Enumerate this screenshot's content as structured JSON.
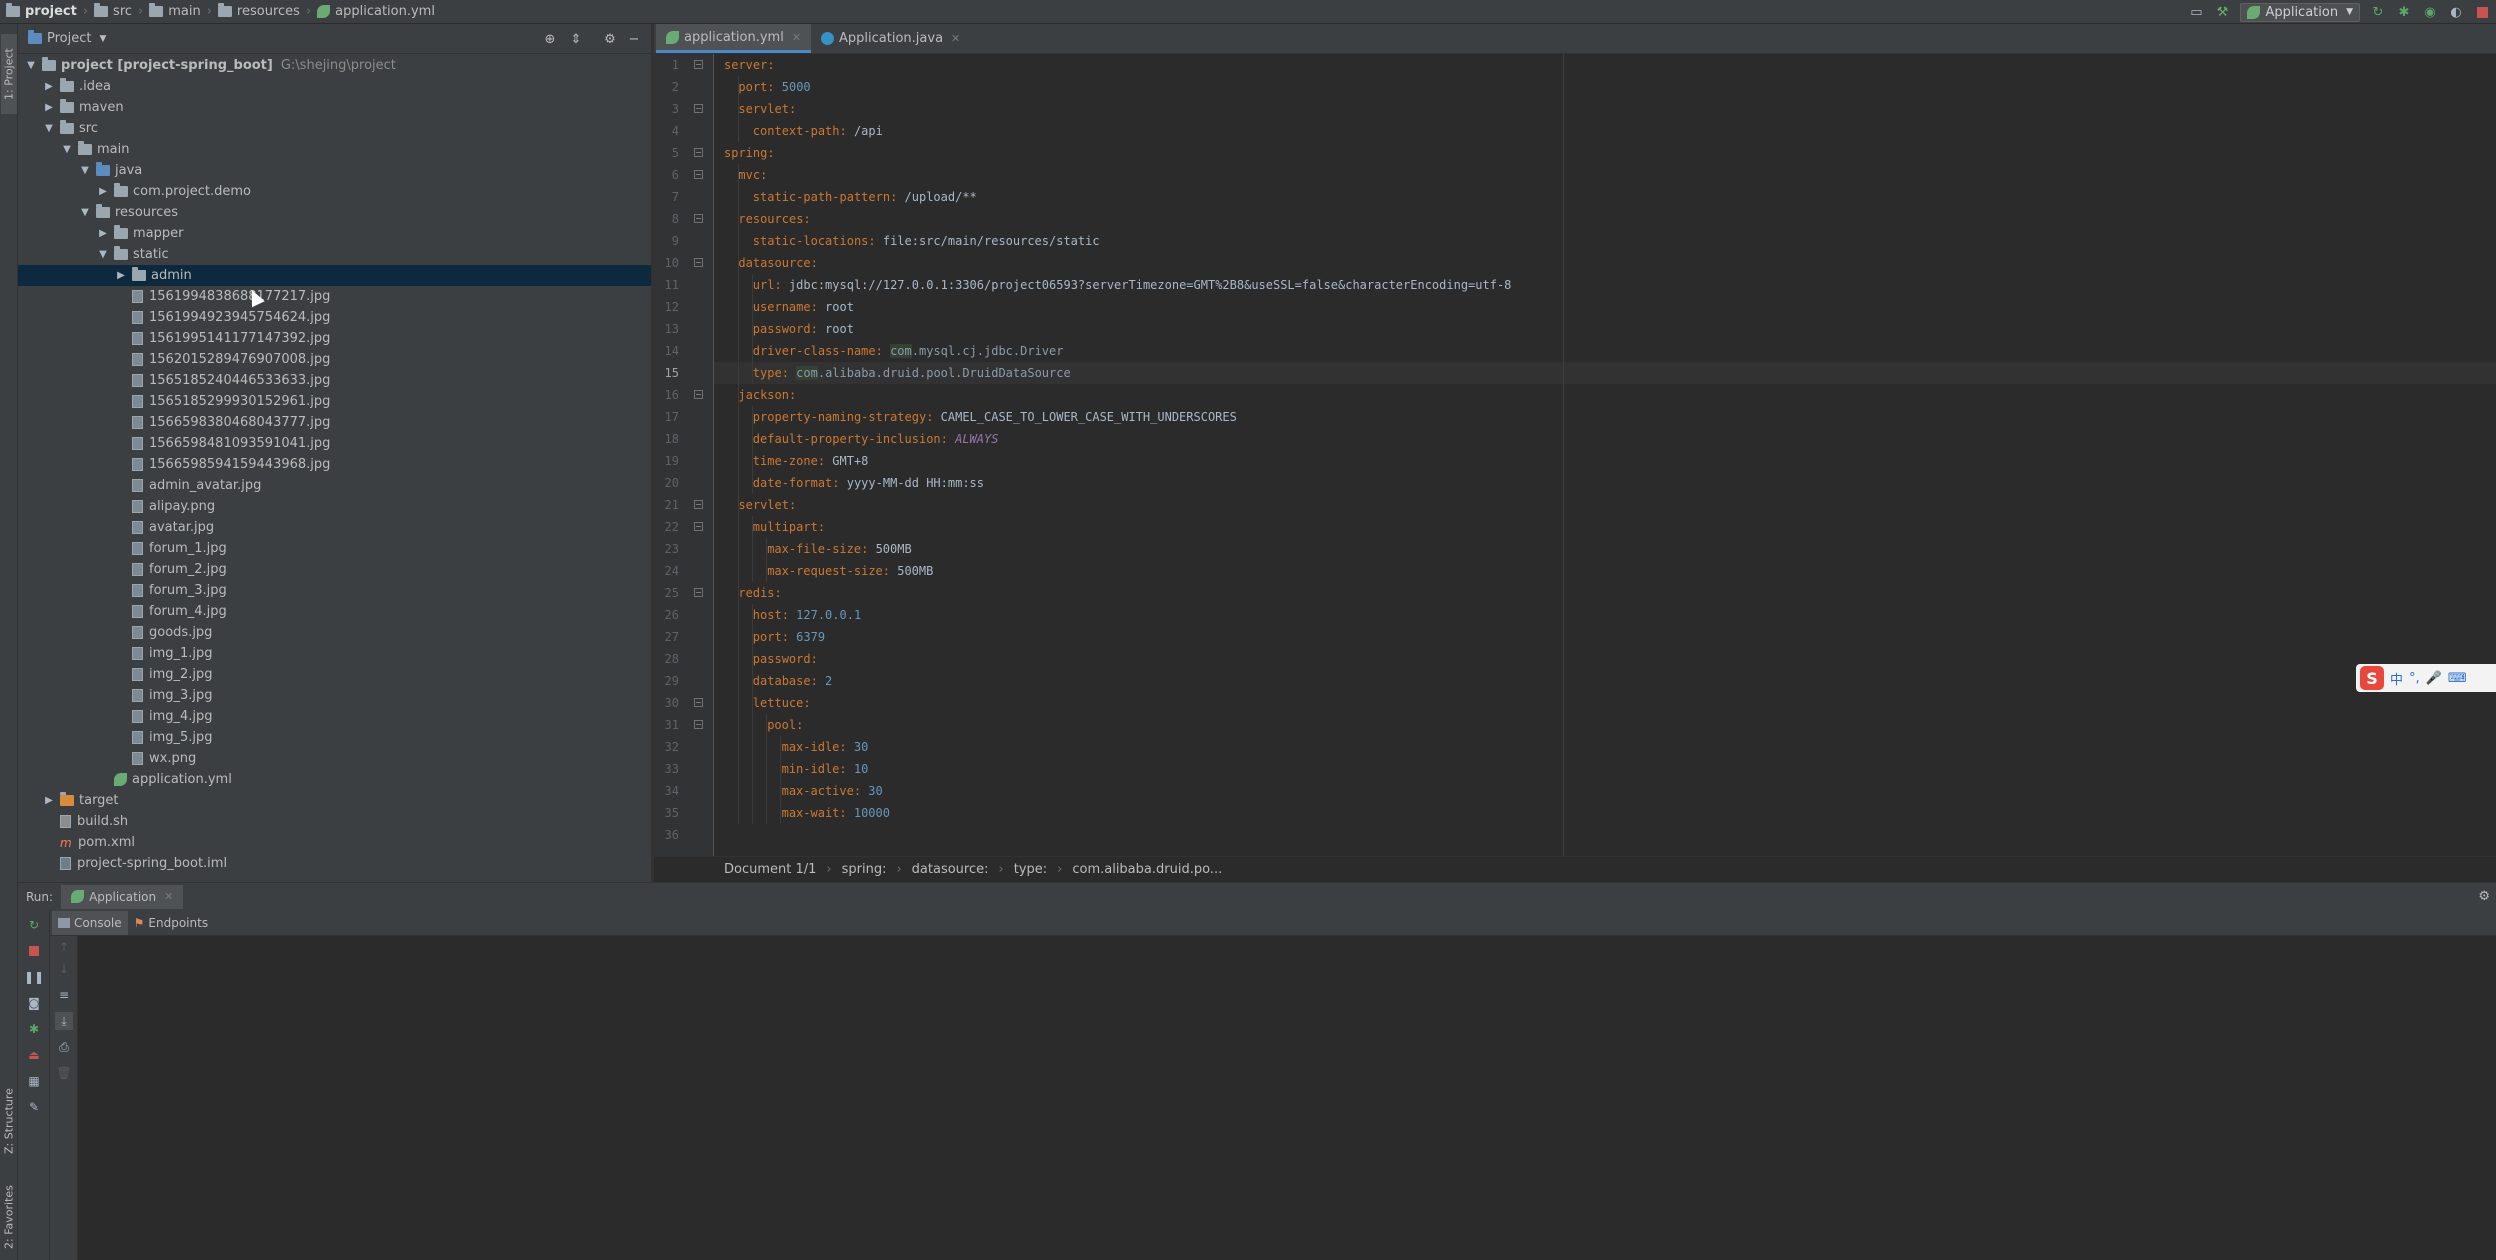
{
  "navbar": {
    "crumbs": [
      "project",
      "src",
      "main",
      "resources",
      "application.yml"
    ],
    "run_config": "Application"
  },
  "left_stripe": {
    "project_tab": "1: Project",
    "structure_tab": "Z: Structure",
    "favorites_tab": "2: Favorites"
  },
  "project_panel": {
    "title": "Project",
    "tree": [
      {
        "label": "project [project-spring_boot]",
        "suffix": "G:\\shejing\\project"
      },
      {
        "label": ".idea"
      },
      {
        "label": "maven"
      },
      {
        "label": "src"
      },
      {
        "label": "main"
      },
      {
        "label": "java"
      },
      {
        "label": "com.project.demo"
      },
      {
        "label": "resources"
      },
      {
        "label": "mapper"
      },
      {
        "label": "static"
      },
      {
        "label": "admin"
      },
      {
        "label": "1561994838688177217.jpg"
      },
      {
        "label": "1561994923945754624.jpg"
      },
      {
        "label": "1561995141177147392.jpg"
      },
      {
        "label": "1562015289476907008.jpg"
      },
      {
        "label": "1565185240446533633.jpg"
      },
      {
        "label": "1565185299930152961.jpg"
      },
      {
        "label": "1566598380468043777.jpg"
      },
      {
        "label": "1566598481093591041.jpg"
      },
      {
        "label": "1566598594159443968.jpg"
      },
      {
        "label": "admin_avatar.jpg"
      },
      {
        "label": "alipay.png"
      },
      {
        "label": "avatar.jpg"
      },
      {
        "label": "forum_1.jpg"
      },
      {
        "label": "forum_2.jpg"
      },
      {
        "label": "forum_3.jpg"
      },
      {
        "label": "forum_4.jpg"
      },
      {
        "label": "goods.jpg"
      },
      {
        "label": "img_1.jpg"
      },
      {
        "label": "img_2.jpg"
      },
      {
        "label": "img_3.jpg"
      },
      {
        "label": "img_4.jpg"
      },
      {
        "label": "img_5.jpg"
      },
      {
        "label": "wx.png"
      },
      {
        "label": "application.yml"
      },
      {
        "label": "target"
      },
      {
        "label": "build.sh"
      },
      {
        "label": "pom.xml"
      },
      {
        "label": "project-spring_boot.iml"
      }
    ]
  },
  "editor": {
    "tabs": [
      {
        "label": "application.yml"
      },
      {
        "label": "Application.java"
      }
    ],
    "current_line": "15",
    "line_numbers": [
      "1",
      "2",
      "3",
      "4",
      "5",
      "6",
      "7",
      "8",
      "9",
      "10",
      "11",
      "12",
      "13",
      "14",
      "15",
      "16",
      "17",
      "18",
      "19",
      "20",
      "21",
      "22",
      "23",
      "24",
      "25",
      "26",
      "27",
      "28",
      "29",
      "30",
      "31",
      "32",
      "33",
      "34",
      "35",
      "36"
    ],
    "code": [
      {
        "key": "server",
        "sep": ":",
        "val": ""
      },
      {
        "key": "port",
        "sep": ": ",
        "val": "5000"
      },
      {
        "key": "servlet",
        "sep": ":",
        "val": ""
      },
      {
        "key": "context-path",
        "sep": ": ",
        "val": "/api"
      },
      {
        "key": "spring",
        "sep": ":",
        "val": ""
      },
      {
        "key": "mvc",
        "sep": ":",
        "val": ""
      },
      {
        "key": "static-path-pattern",
        "sep": ": ",
        "val": "/upload/**"
      },
      {
        "key": "resources",
        "sep": ":",
        "val": ""
      },
      {
        "key": "static-locations",
        "sep": ": ",
        "val": "file:src/main/resources/static"
      },
      {
        "key": "datasource",
        "sep": ":",
        "val": ""
      },
      {
        "key": "url",
        "sep": ": ",
        "val": "jdbc:mysql://127.0.0.1:3306/project06593?serverTimezone=GMT%2B8&useSSL=false&characterEncoding=utf-8"
      },
      {
        "key": "username",
        "sep": ": ",
        "val": "root"
      },
      {
        "key": "password",
        "sep": ": ",
        "val": "root"
      },
      {
        "key": "driver-class-name",
        "sep": ": ",
        "val_hl": "com",
        "val": ".mysql.cj.jdbc.Driver"
      },
      {
        "key": "type",
        "sep": ": ",
        "val_hl": "com",
        "val": ".alibaba.druid.pool.DruidDataSource"
      },
      {
        "key": "jackson",
        "sep": ":",
        "val": ""
      },
      {
        "key": "property-naming-strategy",
        "sep": ": ",
        "val": "CAMEL_CASE_TO_LOWER_CASE_WITH_UNDERSCORES"
      },
      {
        "key": "default-property-inclusion",
        "sep": ": ",
        "val": "ALWAYS"
      },
      {
        "key": "time-zone",
        "sep": ": ",
        "val": "GMT+8"
      },
      {
        "key": "date-format",
        "sep": ": ",
        "val": "yyyy-MM-dd HH:mm:ss"
      },
      {
        "key": "servlet",
        "sep": ":",
        "val": ""
      },
      {
        "key": "multipart",
        "sep": ":",
        "val": ""
      },
      {
        "key": "max-file-size",
        "sep": ": ",
        "val": "500MB"
      },
      {
        "key": "max-request-size",
        "sep": ": ",
        "val": "500MB"
      },
      {
        "key": "redis",
        "sep": ":",
        "val": ""
      },
      {
        "key": "host",
        "sep": ": ",
        "val": "127.0.0.1"
      },
      {
        "key": "port",
        "sep": ": ",
        "val": "6379"
      },
      {
        "key": "password",
        "sep": ":",
        "val": ""
      },
      {
        "key": "database",
        "sep": ": ",
        "val": "2"
      },
      {
        "key": "lettuce",
        "sep": ":",
        "val": ""
      },
      {
        "key": "pool",
        "sep": ":",
        "val": ""
      },
      {
        "key": "max-idle",
        "sep": ": ",
        "val": "30"
      },
      {
        "key": "min-idle",
        "sep": ": ",
        "val": "10"
      },
      {
        "key": "max-active",
        "sep": ": ",
        "val": "30"
      },
      {
        "key": "max-wait",
        "sep": ": ",
        "val": "10000"
      },
      {
        "key": "",
        "sep": "",
        "val": ""
      }
    ],
    "breadcrumbs": [
      "Document 1/1",
      "spring:",
      "datasource:",
      "type:",
      "com.alibaba.druid.po..."
    ]
  },
  "run_panel": {
    "label": "Run:",
    "tab": "Application",
    "subtabs": [
      "Console",
      "Endpoints"
    ]
  },
  "ime": {
    "logo": "S",
    "mode": "中",
    "punct": "°,",
    "voice": "🎤",
    "keyboard": "⌨"
  },
  "colors": {
    "accent": "#4a88c7",
    "keyword": "#cc7832",
    "number": "#6897bb",
    "selection": "#0d293e"
  }
}
